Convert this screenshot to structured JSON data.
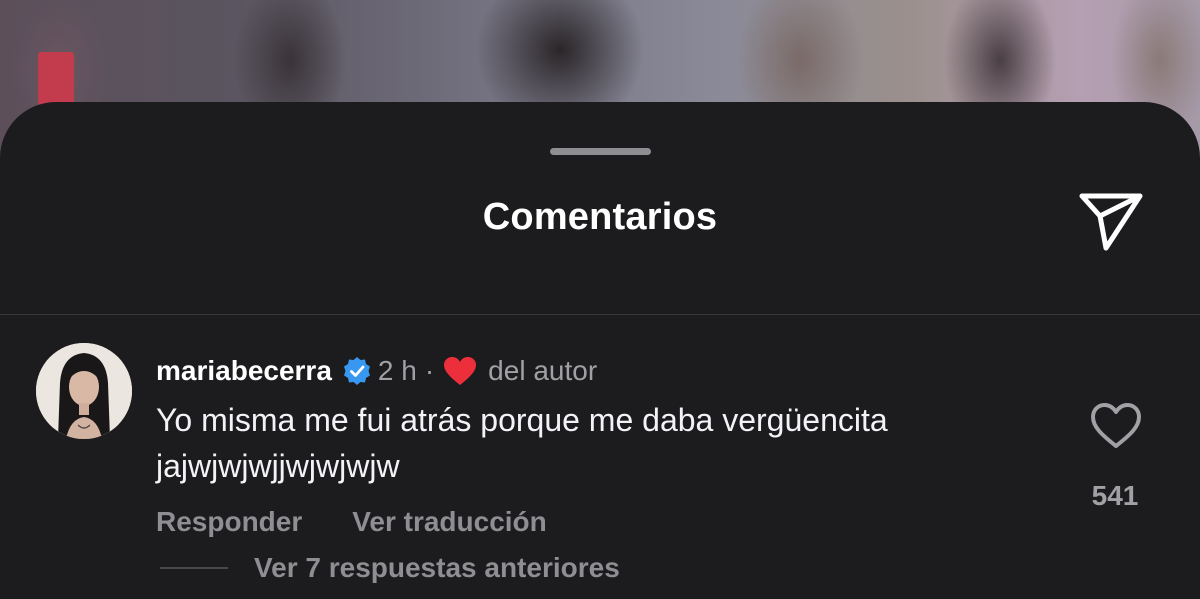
{
  "sheet": {
    "title": "Comentarios",
    "share_icon": "paper-plane-icon"
  },
  "comment": {
    "username": "mariabecerra",
    "verified_icon": "verified-badge-icon",
    "time": "2 h",
    "separator": "·",
    "author_like_icon": "red-heart-icon",
    "author_like_label": "del autor",
    "text_line1": "Yo misma me fui atrás porque me daba vergüencita",
    "text_line2": "jajwjwjwjjwjwjwjw",
    "like_icon": "heart-outline-icon",
    "like_count": "541",
    "reply_label": "Responder",
    "translate_label": "Ver traducción",
    "view_replies_label": "Ver 7 respuestas anteriores"
  },
  "colors": {
    "sheet_bg": "#1c1c1e",
    "text_primary": "#ffffff",
    "text_secondary": "#a0a0a5",
    "verified_blue": "#3897f0",
    "heart_red": "#ed2f3b"
  }
}
